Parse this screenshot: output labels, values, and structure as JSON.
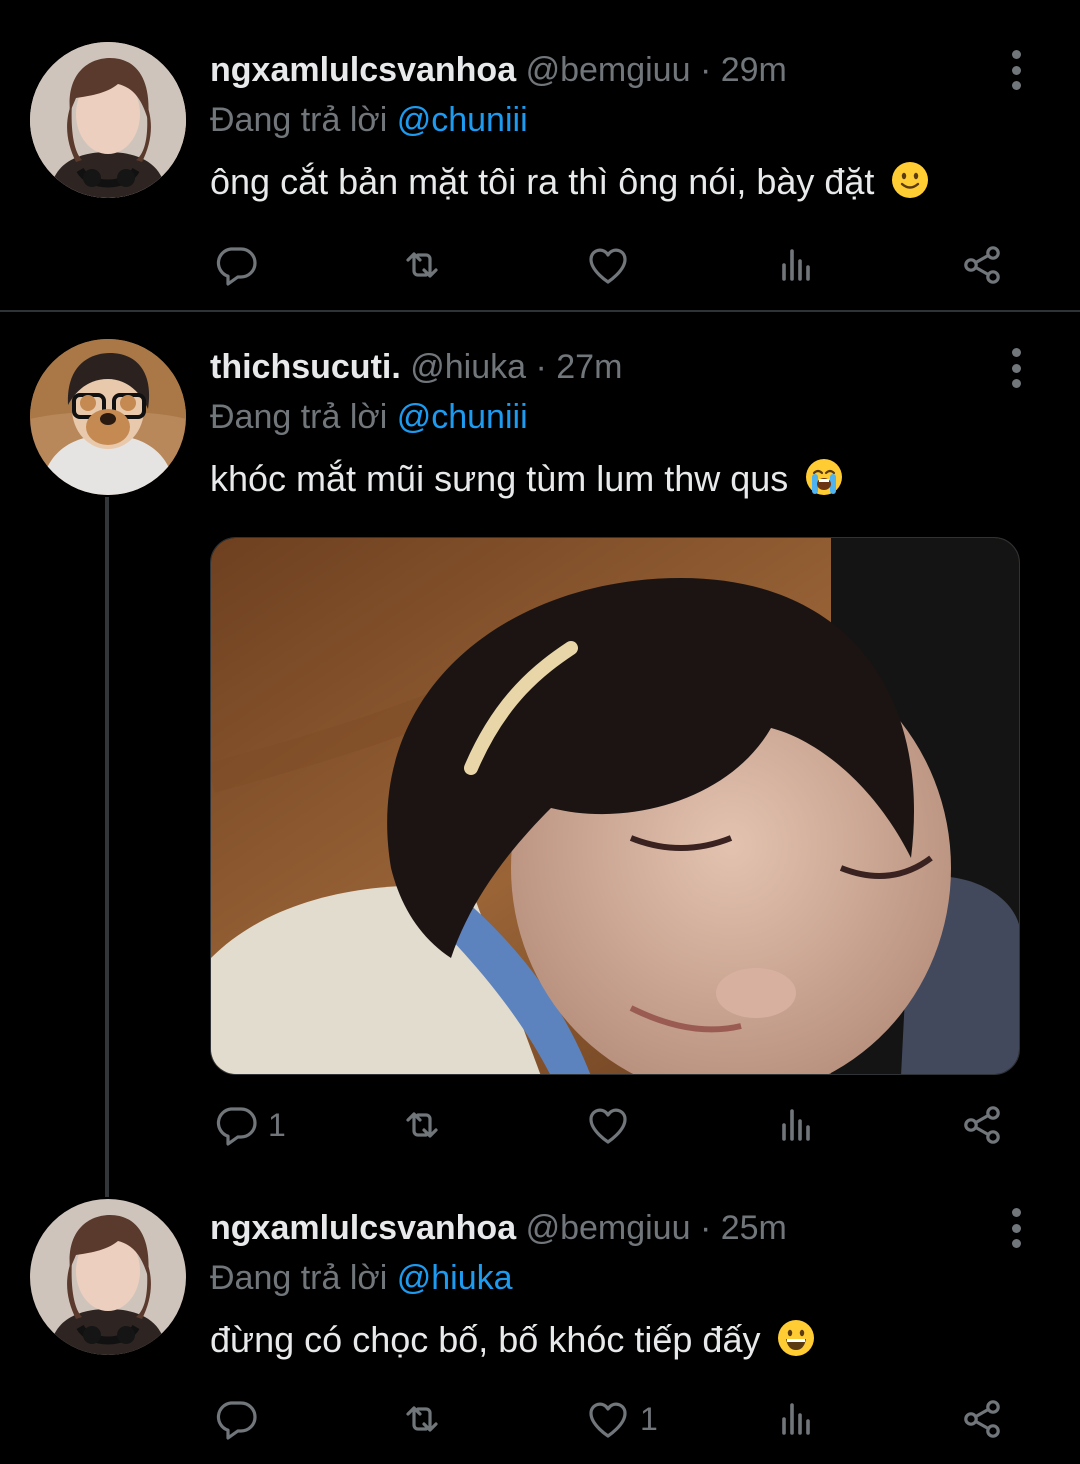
{
  "tweets": [
    {
      "display_name": "ngxamlulcsvanhoa",
      "handle": "@bemgiuu",
      "time": "· 29m",
      "reply_prefix": "Đang trả lời",
      "reply_to": "@chuniii",
      "text": "ông cắt bản mặt tôi ra thì ông nói, bày đặt",
      "emoji": "slightly-smiling-face",
      "replies": "",
      "likes": ""
    },
    {
      "display_name": "thichsucuti.",
      "handle": "@hiuka",
      "time": "· 27m",
      "reply_prefix": "Đang trả lời",
      "reply_to": "@chuniii",
      "text": "khóc mắt mũi sưng tùm lum thw qus",
      "emoji": "loudly-crying-face",
      "replies": "1",
      "likes": ""
    },
    {
      "display_name": "ngxamlulcsvanhoa",
      "handle": "@bemgiuu",
      "time": "· 25m",
      "reply_prefix": "Đang trả lời",
      "reply_to": "@hiuka",
      "text": "đừng có chọc bố, bố khóc tiếp đấy",
      "emoji": "grinning-face",
      "replies": "",
      "likes": "1"
    }
  ],
  "colors": {
    "background": "#000000",
    "text": "#e7e9ea",
    "muted": "#71767b",
    "accent": "#1d9bf0",
    "divider": "#2f3336"
  },
  "icons": [
    "reply-icon",
    "retweet-icon",
    "like-icon",
    "views-icon",
    "share-icon",
    "more-options-icon"
  ]
}
